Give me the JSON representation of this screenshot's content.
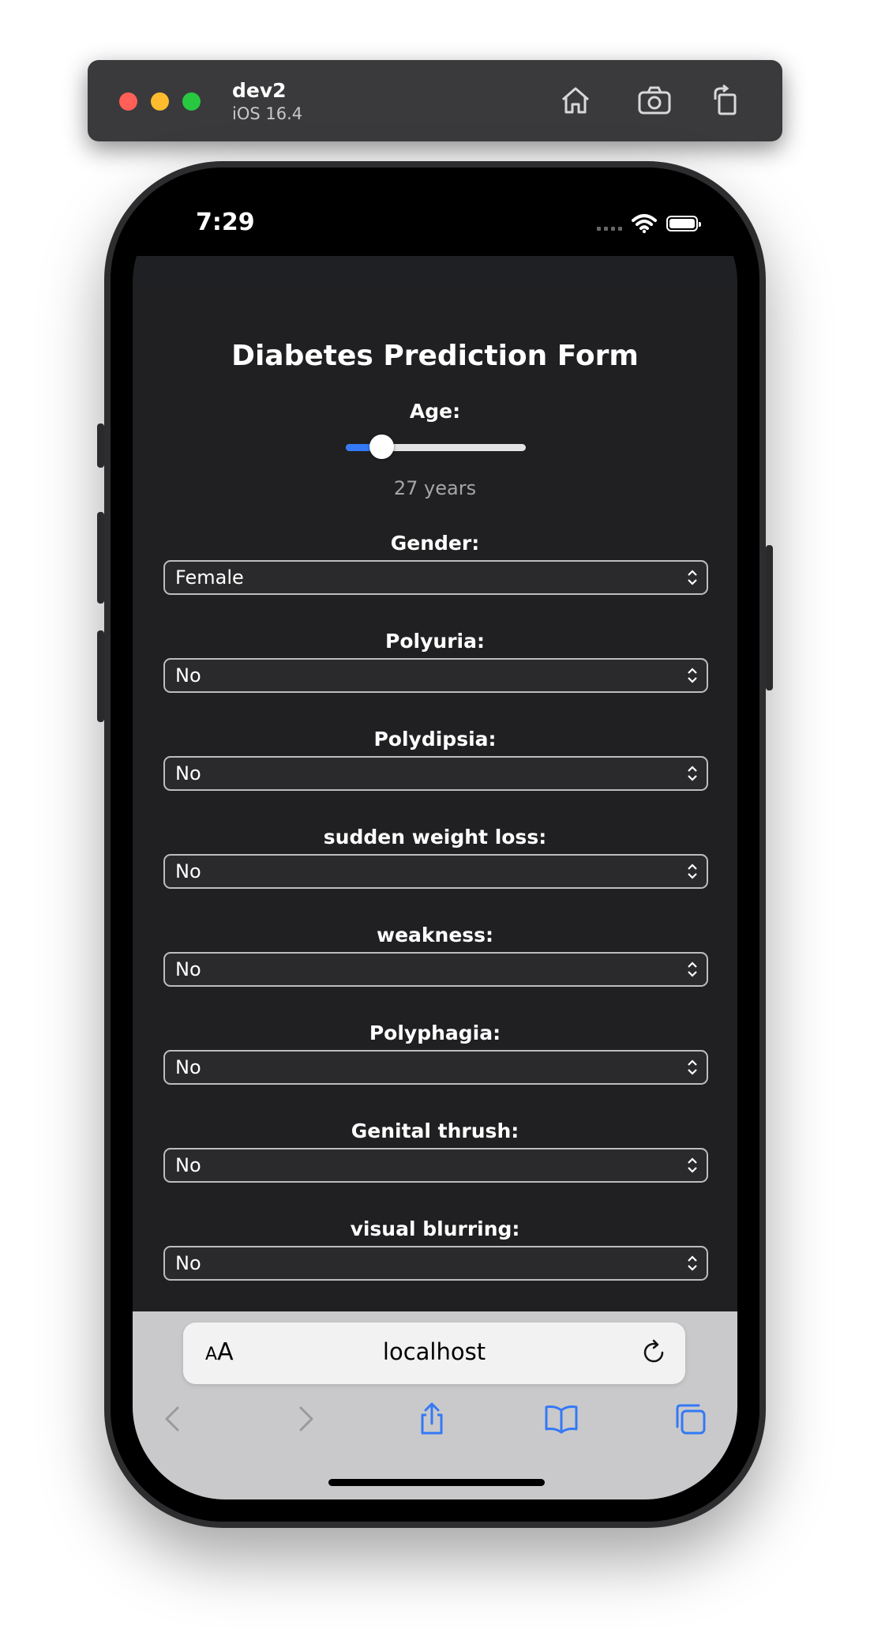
{
  "simulator": {
    "device_name": "dev2",
    "os_version": "iOS 16.4",
    "home_icon": "home-icon",
    "screenshot_icon": "camera-icon",
    "rotate_icon": "rotate-icon"
  },
  "status_bar": {
    "time": "7:29"
  },
  "form": {
    "title": "Diabetes Prediction Form",
    "age": {
      "label": "Age:",
      "value_text": "27 years",
      "slider_fraction": 0.2
    },
    "fields": [
      {
        "label": "Gender:",
        "value": "Female"
      },
      {
        "label": "Polyuria:",
        "value": "No"
      },
      {
        "label": "Polydipsia:",
        "value": "No"
      },
      {
        "label": "sudden weight loss:",
        "value": "No"
      },
      {
        "label": "weakness:",
        "value": "No"
      },
      {
        "label": "Polyphagia:",
        "value": "No"
      },
      {
        "label": "Genital thrush:",
        "value": "No"
      },
      {
        "label": "visual blurring:",
        "value": "No"
      }
    ]
  },
  "safari": {
    "text_size_label_small": "A",
    "text_size_label_big": "A",
    "url": "localhost"
  },
  "colors": {
    "accent": "#3479f6",
    "page_bg": "#202022"
  }
}
